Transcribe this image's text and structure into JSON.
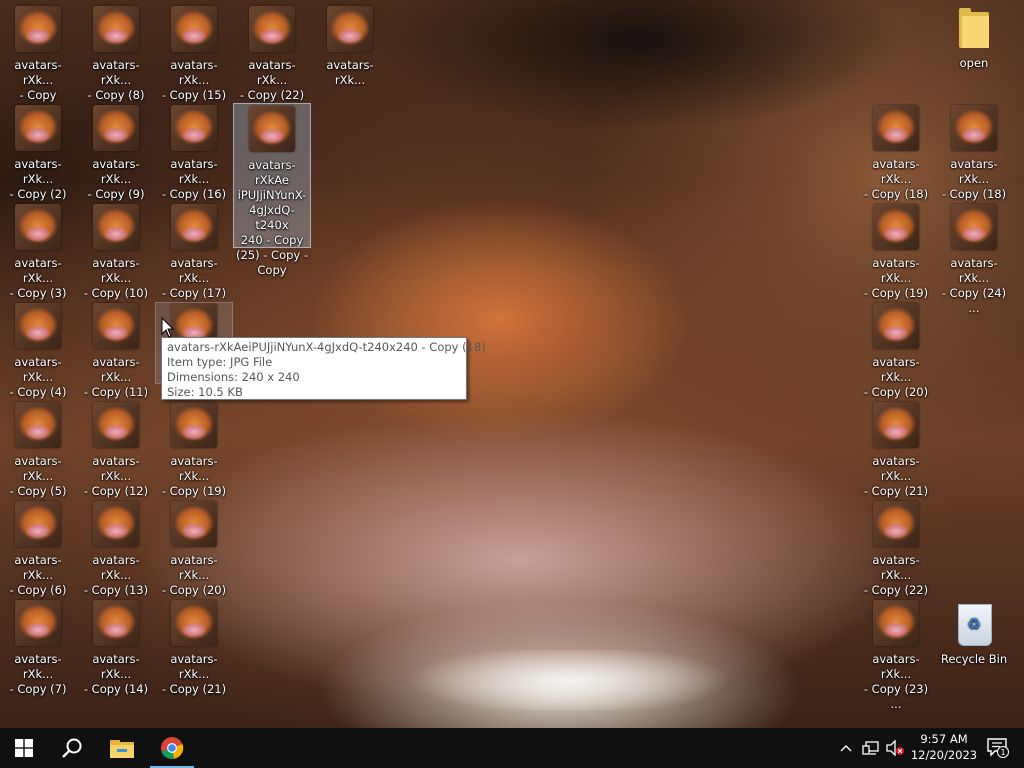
{
  "desktop": {
    "icons_col1": [
      {
        "line1": "avatars-rXk...",
        "line2": "- Copy"
      },
      {
        "line1": "avatars-rXk...",
        "line2": "- Copy (2)"
      },
      {
        "line1": "avatars-rXk...",
        "line2": "- Copy (3)"
      },
      {
        "line1": "avatars-rXk...",
        "line2": "- Copy (4)"
      },
      {
        "line1": "avatars-rXk...",
        "line2": "- Copy (5)"
      },
      {
        "line1": "avatars-rXk...",
        "line2": "- Copy (6)"
      },
      {
        "line1": "avatars-rXk...",
        "line2": "- Copy (7)"
      }
    ],
    "icons_col2": [
      {
        "line1": "avatars-rXk...",
        "line2": "- Copy (8)"
      },
      {
        "line1": "avatars-rXk...",
        "line2": "- Copy (9)"
      },
      {
        "line1": "avatars-rXk...",
        "line2": "- Copy (10)"
      },
      {
        "line1": "avatars-rXk...",
        "line2": "- Copy (11)"
      },
      {
        "line1": "avatars-rXk...",
        "line2": "- Copy (12)"
      },
      {
        "line1": "avatars-rXk...",
        "line2": "- Copy (13)"
      },
      {
        "line1": "avatars-rXk...",
        "line2": "- Copy (14)"
      }
    ],
    "icons_col3": [
      {
        "line1": "avatars-rXk...",
        "line2": "- Copy (15)"
      },
      {
        "line1": "avatars-rXk...",
        "line2": "- Copy (16)"
      },
      {
        "line1": "avatars-rXk...",
        "line2": "- Copy (17)"
      },
      {
        "line1": "",
        "line2": ""
      },
      {
        "line1": "avatars-rXk...",
        "line2": "- Copy (19)"
      },
      {
        "line1": "avatars-rXk...",
        "line2": "- Copy (20)"
      },
      {
        "line1": "avatars-rXk...",
        "line2": "- Copy (21)"
      }
    ],
    "icon_col4_top": {
      "line1": "avatars-rXk...",
      "line2": "- Copy (22)"
    },
    "icon_col5_top": {
      "line1": "avatars-rXk..."
    },
    "selected_icon": {
      "lines": [
        "avatars-rXkAe",
        "iPUJjiNYunX-",
        "4gJxdQ-t240x",
        "240 - Copy",
        "(25) - Copy -",
        "Copy"
      ]
    },
    "folder_open": {
      "label": "open"
    },
    "icons_right_a": [
      {
        "line1": "avatars-rXk...",
        "line2": "- Copy (18) ..."
      },
      {
        "line1": "avatars-rXk...",
        "line2": "- Copy (19) ..."
      },
      {
        "line1": "avatars-rXk...",
        "line2": "- Copy (20) ..."
      },
      {
        "line1": "avatars-rXk...",
        "line2": "- Copy (21) ..."
      },
      {
        "line1": "avatars-rXk...",
        "line2": "- Copy (22) ..."
      },
      {
        "line1": "avatars-rXk...",
        "line2": "- Copy (23) ..."
      }
    ],
    "icons_right_b": [
      {
        "line1": "avatars-rXk...",
        "line2": "- Copy (18) ..."
      },
      {
        "line1": "avatars-rXk...",
        "line2": "- Copy (24) ..."
      }
    ],
    "recycle_bin": {
      "label": "Recycle Bin"
    }
  },
  "tooltip": {
    "name": "avatars-rXkAeiPUJjiNYunX-4gJxdQ-t240x240 - Copy (18)",
    "type": "Item type: JPG File",
    "dimensions": "Dimensions: 240 x 240",
    "size": "Size: 10.5 KB"
  },
  "taskbar": {
    "start_icon": "windows-logo-icon",
    "search_icon": "search-icon",
    "pinned": [
      "file-explorer-icon",
      "chrome-icon"
    ],
    "clock": {
      "time": "9:57 AM",
      "date": "12/20/2023"
    },
    "notification_count": "1",
    "accent_color": "#76b9ed"
  }
}
